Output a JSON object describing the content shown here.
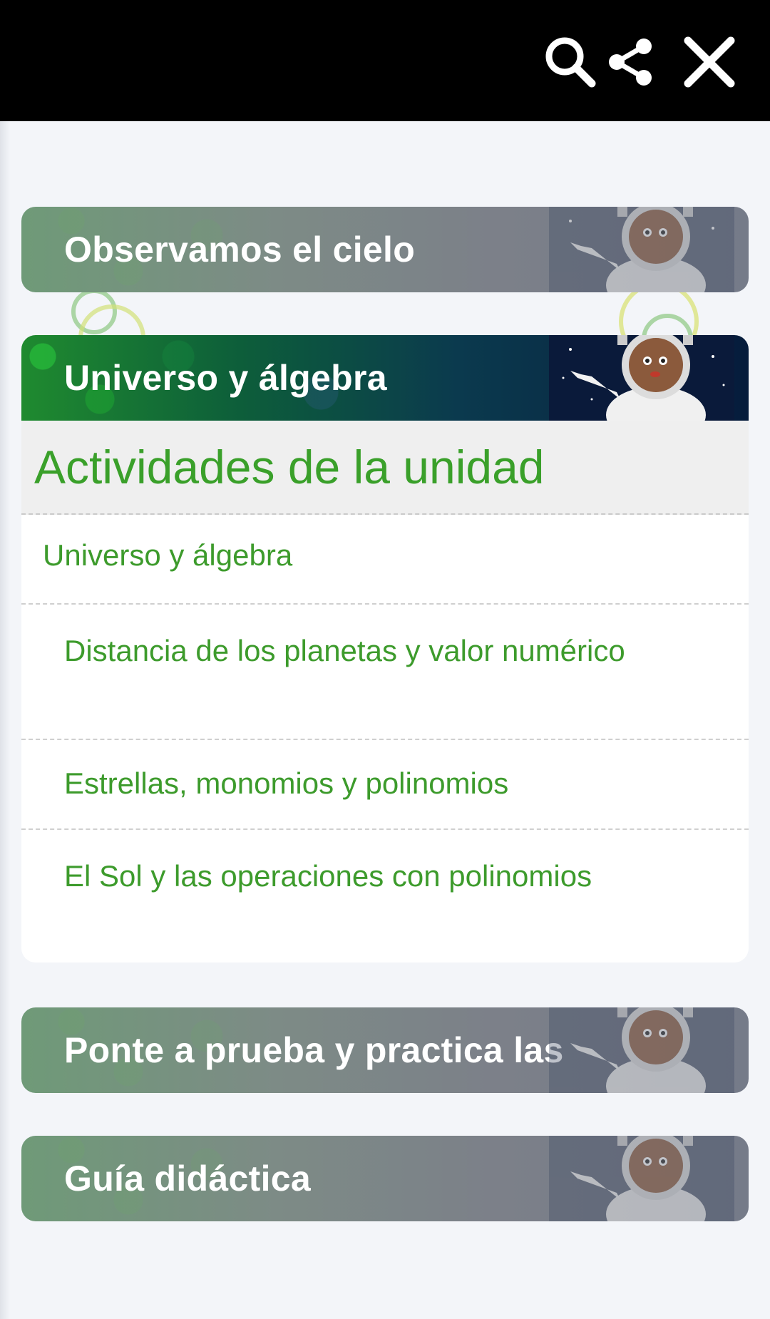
{
  "topbar": {
    "icons": [
      "search-icon",
      "share-icon",
      "close-icon"
    ]
  },
  "sections": [
    {
      "title": "Observamos el cielo",
      "state": "collapsed"
    },
    {
      "title": "Universo y álgebra",
      "state": "expanded"
    },
    {
      "title": "Ponte a prueba y practica las",
      "state": "collapsed"
    },
    {
      "title": "Guía didáctica",
      "state": "collapsed"
    }
  ],
  "panel": {
    "heading": "Actividades de la unidad",
    "items": [
      {
        "label": "Universo y álgebra",
        "level": 1
      },
      {
        "label": "Distancia de los planetas y valor numérico",
        "level": 2
      },
      {
        "label": "Estrellas, monomios y polinomios",
        "level": 2
      },
      {
        "label": "El Sol y las operaciones con polinomios",
        "level": 2
      }
    ]
  },
  "colors": {
    "accent_green": "#3d9b2c",
    "topbar": "#000000",
    "background": "#f2f4f8"
  }
}
